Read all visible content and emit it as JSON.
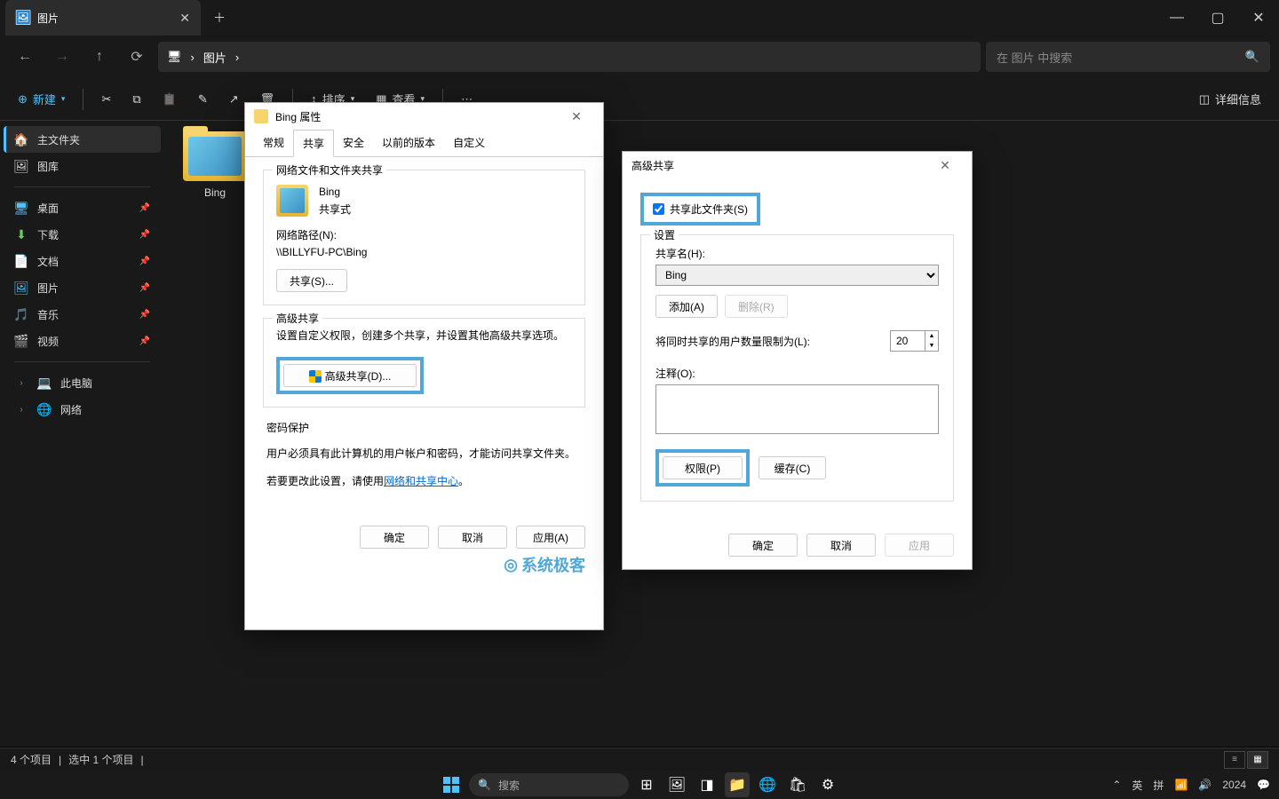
{
  "window": {
    "tab_title": "图片",
    "minimize": "—",
    "maximize": "▢",
    "close": "✕"
  },
  "nav": {
    "crumb_main": "图片",
    "search_placeholder": "在 图片 中搜索"
  },
  "toolbar": {
    "new": "新建",
    "sort": "排序",
    "view": "查看",
    "details": "详细信息"
  },
  "sidebar": {
    "home": "主文件夹",
    "gallery": "图库",
    "desktop": "桌面",
    "downloads": "下载",
    "documents": "文档",
    "pictures": "图片",
    "music": "音乐",
    "videos": "视频",
    "thispc": "此电脑",
    "network": "网络"
  },
  "content": {
    "folder1": "Bing"
  },
  "statusbar": {
    "count": "4 个项目",
    "selected": "选中 1 个项目"
  },
  "props": {
    "title": "Bing 属性",
    "tabs": {
      "general": "常规",
      "sharing": "共享",
      "security": "安全",
      "previous": "以前的版本",
      "custom": "自定义"
    },
    "netshare_group": "网络文件和文件夹共享",
    "folder_name": "Bing",
    "share_status": "共享式",
    "netpath_label": "网络路径(N):",
    "netpath_value": "\\\\BILLYFU-PC\\Bing",
    "share_btn": "共享(S)...",
    "adv_group": "高级共享",
    "adv_desc": "设置自定义权限，创建多个共享，并设置其他高级共享选项。",
    "adv_btn": "高级共享(D)...",
    "pwd_group": "密码保护",
    "pwd_desc1": "用户必须具有此计算机的用户帐户和密码，才能访问共享文件夹。",
    "pwd_desc2_pre": "若要更改此设置，请使用",
    "pwd_link": "网络和共享中心",
    "ok": "确定",
    "cancel": "取消",
    "apply": "应用(A)",
    "watermark": "系统极客"
  },
  "adv": {
    "title": "高级共享",
    "share_checkbox": "共享此文件夹(S)",
    "settings": "设置",
    "sharename_label": "共享名(H):",
    "sharename_value": "Bing",
    "add": "添加(A)",
    "remove": "删除(R)",
    "limit_label": "将同时共享的用户数量限制为(L):",
    "limit_value": "20",
    "comment_label": "注释(O):",
    "permissions": "权限(P)",
    "cache": "缓存(C)",
    "ok": "确定",
    "cancel": "取消",
    "apply": "应用"
  },
  "taskbar": {
    "search": "搜索",
    "ime1": "英",
    "ime2": "拼",
    "year": "2024"
  }
}
